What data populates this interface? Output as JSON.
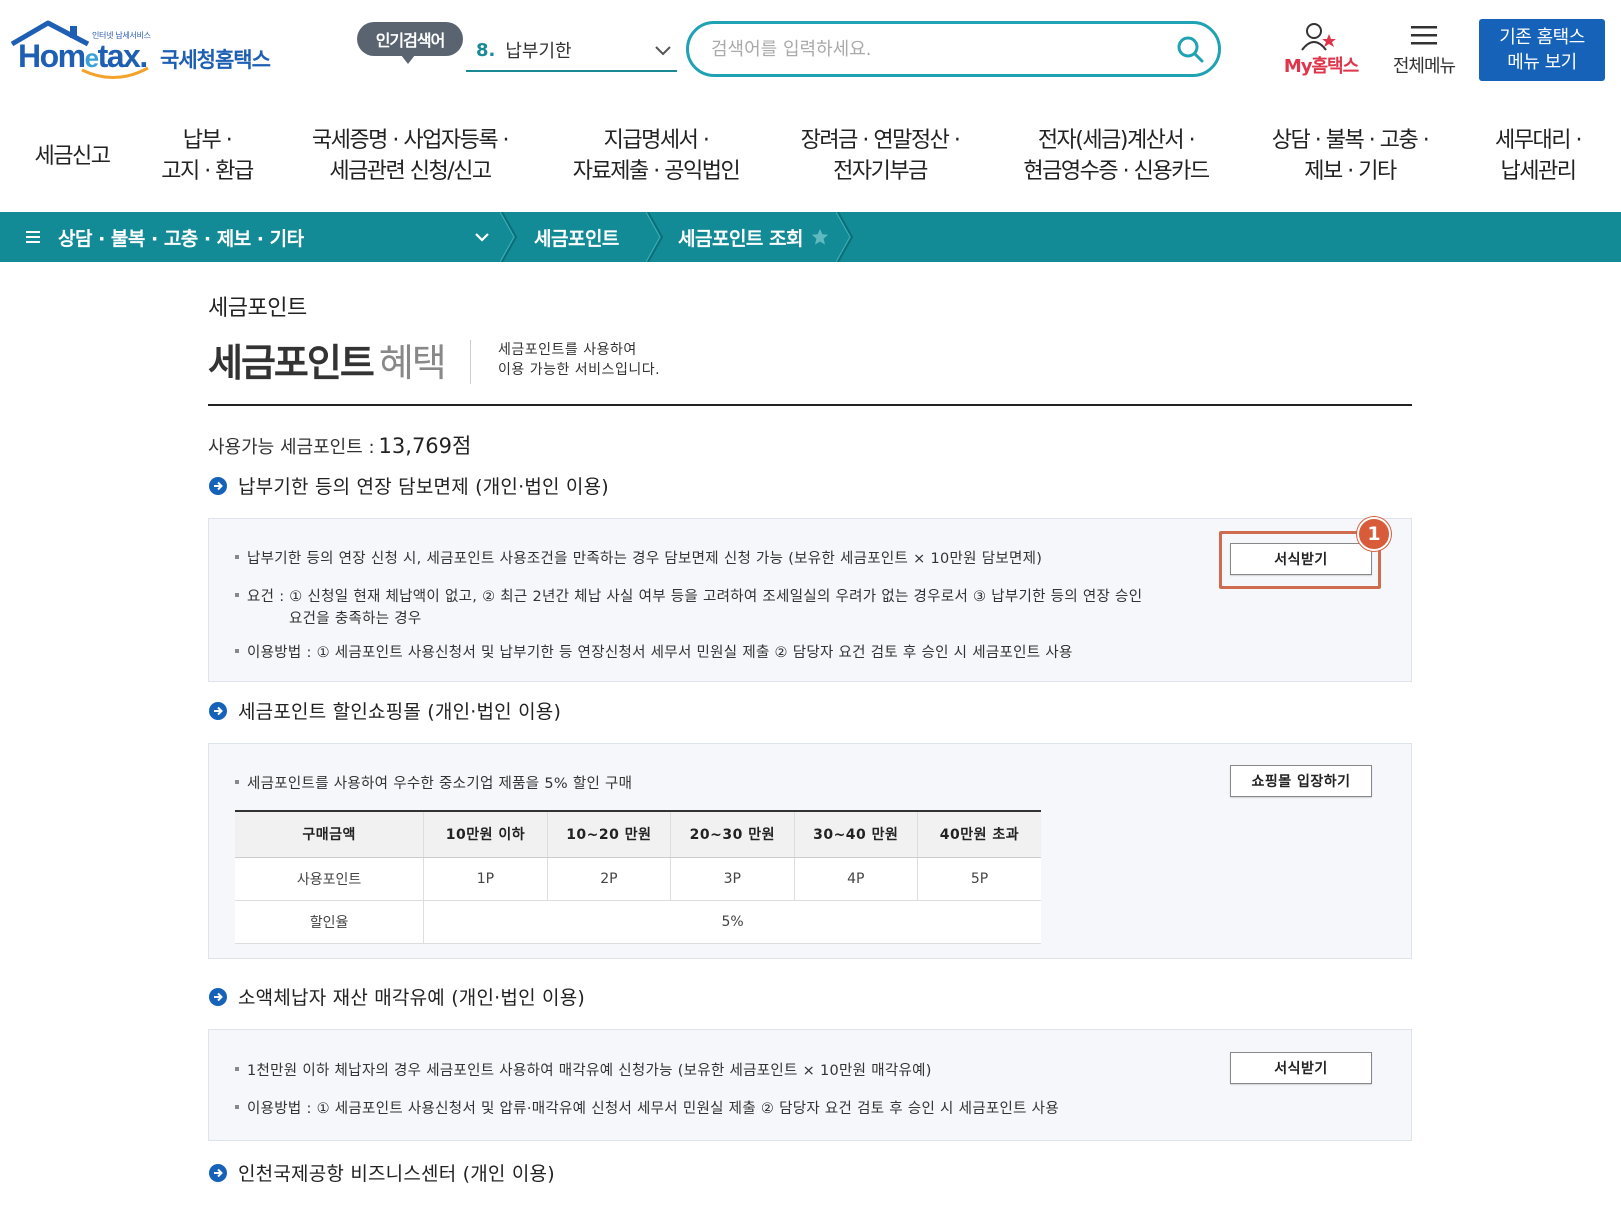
{
  "header": {
    "logo_tagline": "인터넷 납세서비스",
    "logo_word_a": "Hom",
    "logo_word_e": "e",
    "logo_word_b": "tax.",
    "logo_kr": "국세청홈택스",
    "popular_badge": "인기검색어",
    "popular_num": "8.",
    "popular_text": "납부기한",
    "search_placeholder": "검색어를 입력하세요.",
    "my_hometax": "My홈택스",
    "all_menu": "전체메뉴",
    "old_menu_line1": "기존 홈택스",
    "old_menu_line2": "메뉴 보기",
    "accent_color": "#1562b8"
  },
  "main_nav": [
    {
      "line1": "세금신고",
      "line2": ""
    },
    {
      "line1": "납부 ·",
      "line2": "고지 · 환급"
    },
    {
      "line1": "국세증명 · 사업자등록 ·",
      "line2": "세금관련 신청/신고"
    },
    {
      "line1": "지급명세서 ·",
      "line2": "자료제출 · 공익법인"
    },
    {
      "line1": "장려금 · 연말정산 ·",
      "line2": "전자기부금"
    },
    {
      "line1": "전자(세금)계산서 ·",
      "line2": "현금영수증 · 신용카드"
    },
    {
      "line1": "상담 · 불복 · 고충 ·",
      "line2": "제보 · 기타"
    },
    {
      "line1": "세무대리 ·",
      "line2": "납세관리"
    }
  ],
  "breadcrumb": {
    "menu_icon": "≡",
    "level1": "상담 · 불복 · 고충 · 제보 · 기타",
    "level2": "세금포인트",
    "level3": "세금포인트 조회",
    "bar_color": "#138b96"
  },
  "page": {
    "crumb_title": "세금포인트",
    "title_bold": "세금포인트",
    "title_light": "혜택",
    "description": "세금포인트를 사용하여\n이용 가능한 서비스입니다.",
    "points_label": "사용가능 세금포인트 :",
    "points_value": "13,769점"
  },
  "sections": {
    "s1": {
      "heading": "납부기한 등의 연장 담보면제 (개인·법인 이용)",
      "lines": [
        "납부기한 등의 연장 신청 시, 세금포인트 사용조건을 만족하는 경우 담보면제 신청 가능 (보유한 세금포인트 × 10만원 담보면제)",
        "요건 : ① 신청일 현재 체납액이 없고, ② 최근 2년간 체납 사실 여부 등을 고려하여 조세일실의 우려가 없는 경우로서 ③ 납부기한 등의 연장 승인",
        "요건을 충족하는 경우",
        "이용방법 : ① 세금포인트 사용신청서 및 납부기한 등 연장신청서 세무서 민원실 제출 ② 담당자 요건 검토 후 승인 시 세금포인트 사용"
      ],
      "button": "서식받기",
      "step_badge": "1"
    },
    "s2": {
      "heading": "세금포인트 할인쇼핑몰 (개인·법인 이용)",
      "line": "세금포인트를 사용하여 우수한 중소기업 제품을 5% 할인 구매",
      "button": "쇼핑몰 입장하기",
      "table": {
        "headers": [
          "구매금액",
          "10만원 이하",
          "10~20 만원",
          "20~30 만원",
          "30~40 만원",
          "40만원 초과"
        ],
        "row1_label": "사용포인트",
        "row1": [
          "1P",
          "2P",
          "3P",
          "4P",
          "5P"
        ],
        "row2_label": "할인율",
        "row2_value": "5%"
      }
    },
    "s3": {
      "heading": "소액체납자 재산 매각유예 (개인·법인 이용)",
      "lines": [
        "1천만원 이하 체납자의 경우 세금포인트 사용하여 매각유예 신청가능 (보유한 세금포인트 × 10만원 매각유예)",
        "이용방법 : ① 세금포인트 사용신청서 및 압류·매각유예 신청서 세무서 민원실 제출 ② 담당자 요건 검토 후 승인 시 세금포인트 사용"
      ],
      "button": "서식받기"
    },
    "s4": {
      "heading": "인천국제공항 비즈니스센터 (개인 이용)"
    }
  },
  "icons": {
    "logo": "hometax-house-logo",
    "search": "search-icon",
    "person": "person-icon",
    "hamburger": "hamburger-icon",
    "chevron": "chevron-down-icon",
    "star": "star-icon",
    "section": "arrow-circle-icon"
  }
}
